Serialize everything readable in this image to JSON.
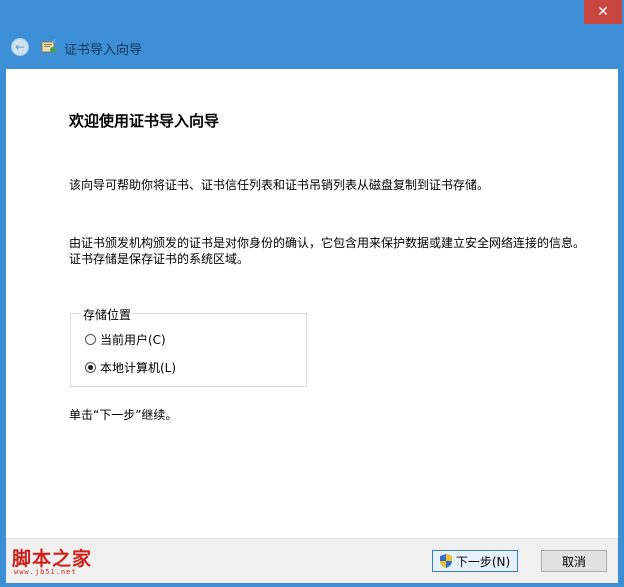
{
  "window": {
    "title": "证书导入向导",
    "close_glyph": "✕"
  },
  "content": {
    "heading": "欢迎使用证书导入向导",
    "paragraph1": "该向导可帮助你将证书、证书信任列表和证书吊销列表从磁盘复制到证书存储。",
    "paragraph2": "由证书颁发机构颁发的证书是对你身份的确认，它包含用来保护数据或建立安全网络连接的信息。证书存储是保存证书的系统区域。",
    "store_location": {
      "legend": "存储位置",
      "options": [
        {
          "label": "当前用户(C)",
          "selected": false
        },
        {
          "label": "本地计算机(L)",
          "selected": true
        }
      ]
    },
    "continue_hint": "单击“下一步”继续。"
  },
  "footer": {
    "watermark": "脚本之家",
    "watermark_url": "www.jb51.net",
    "next_label": "下一步(N)",
    "cancel_label": "取消"
  },
  "colors": {
    "titlebar": "#3c8fd7",
    "close": "#c7463f",
    "watermark": "#d0201a"
  }
}
